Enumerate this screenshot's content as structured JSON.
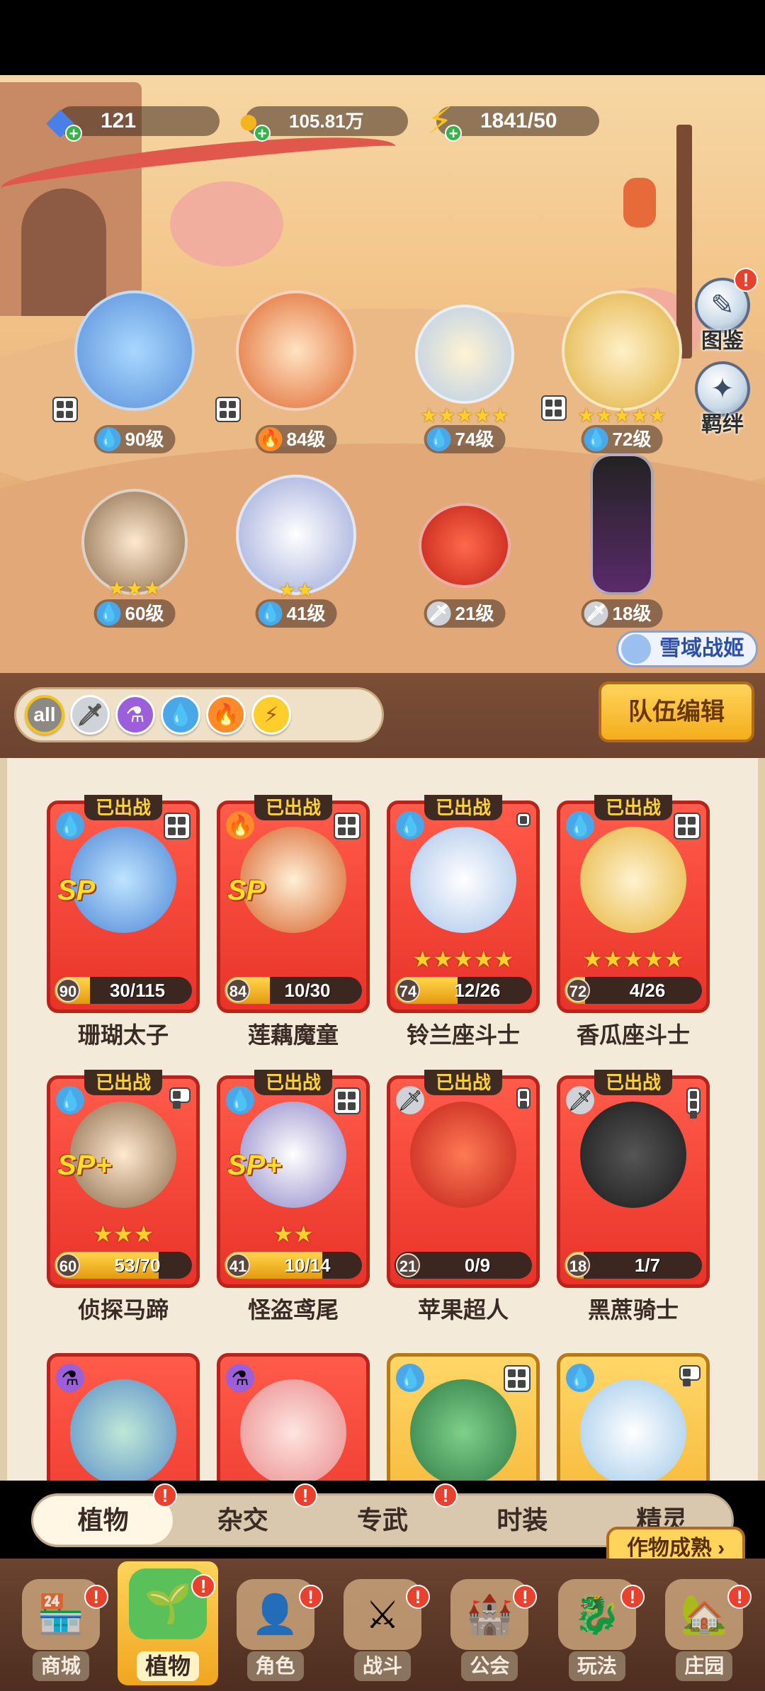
{
  "resources": [
    {
      "icon": "diamond-icon",
      "value": "121"
    },
    {
      "icon": "gold-coin-icon",
      "value": "105.81万"
    },
    {
      "icon": "lightning-icon",
      "value": "1841/50"
    }
  ],
  "side_buttons": {
    "codex": "图鉴",
    "bond": "羁绊"
  },
  "scene_heroes": [
    {
      "level": "90级",
      "element": "water",
      "stars": ""
    },
    {
      "level": "84级",
      "element": "fire",
      "stars": ""
    },
    {
      "level": "74级",
      "element": "water",
      "stars": "★★★★★"
    },
    {
      "level": "72级",
      "element": "water",
      "stars": "★★★★★"
    },
    {
      "level": "60级",
      "element": "water",
      "stars": "★★★"
    },
    {
      "level": "41级",
      "element": "water",
      "stars": "★★"
    },
    {
      "level": "21级",
      "element": "sword",
      "stars": ""
    },
    {
      "level": "18级",
      "element": "sword",
      "stars": ""
    }
  ],
  "snow_tag": "雪域战姬",
  "filters": {
    "all_label": "all"
  },
  "team_edit": "队伍编辑",
  "deployed_label": "已出战",
  "cards": [
    {
      "name": "珊瑚太子",
      "level": "90",
      "progress": "30/115",
      "fill": 0.26,
      "element": "water",
      "sp": "SP",
      "stars": ""
    },
    {
      "name": "莲藕魔童",
      "level": "84",
      "progress": "10/30",
      "fill": 0.33,
      "element": "fire",
      "sp": "SP",
      "stars": ""
    },
    {
      "name": "铃兰座斗士",
      "level": "74",
      "progress": "12/26",
      "fill": 0.46,
      "element": "water",
      "sp": "",
      "stars": "★★★★★"
    },
    {
      "name": "香瓜座斗士",
      "level": "72",
      "progress": "4/26",
      "fill": 0.15,
      "element": "water",
      "sp": "",
      "stars": "★★★★★"
    },
    {
      "name": "侦探马蹄",
      "level": "60",
      "progress": "53/70",
      "fill": 0.76,
      "element": "water",
      "sp": "SP+",
      "stars": "★★★"
    },
    {
      "name": "怪盗鸢尾",
      "level": "41",
      "progress": "10/14",
      "fill": 0.71,
      "element": "water",
      "sp": "SP+",
      "stars": "★★"
    },
    {
      "name": "苹果超人",
      "level": "21",
      "progress": "0/9",
      "fill": 0.0,
      "element": "sword",
      "sp": "",
      "stars": ""
    },
    {
      "name": "黑蔗骑士",
      "level": "18",
      "progress": "1/7",
      "fill": 0.14,
      "element": "sword",
      "sp": "",
      "stars": ""
    }
  ],
  "subtabs": [
    "植物",
    "杂交",
    "专武",
    "时装",
    "精灵"
  ],
  "harvest_button": "作物成熟",
  "nav": [
    "商城",
    "植物",
    "角色",
    "战斗",
    "公会",
    "玩法",
    "庄园"
  ],
  "colors": {
    "accent": "#f4ad1e",
    "card_red": "#e9332a",
    "badge_red": "#e8412d",
    "water": "#4aa7e8",
    "fire": "#ff8a2a"
  }
}
